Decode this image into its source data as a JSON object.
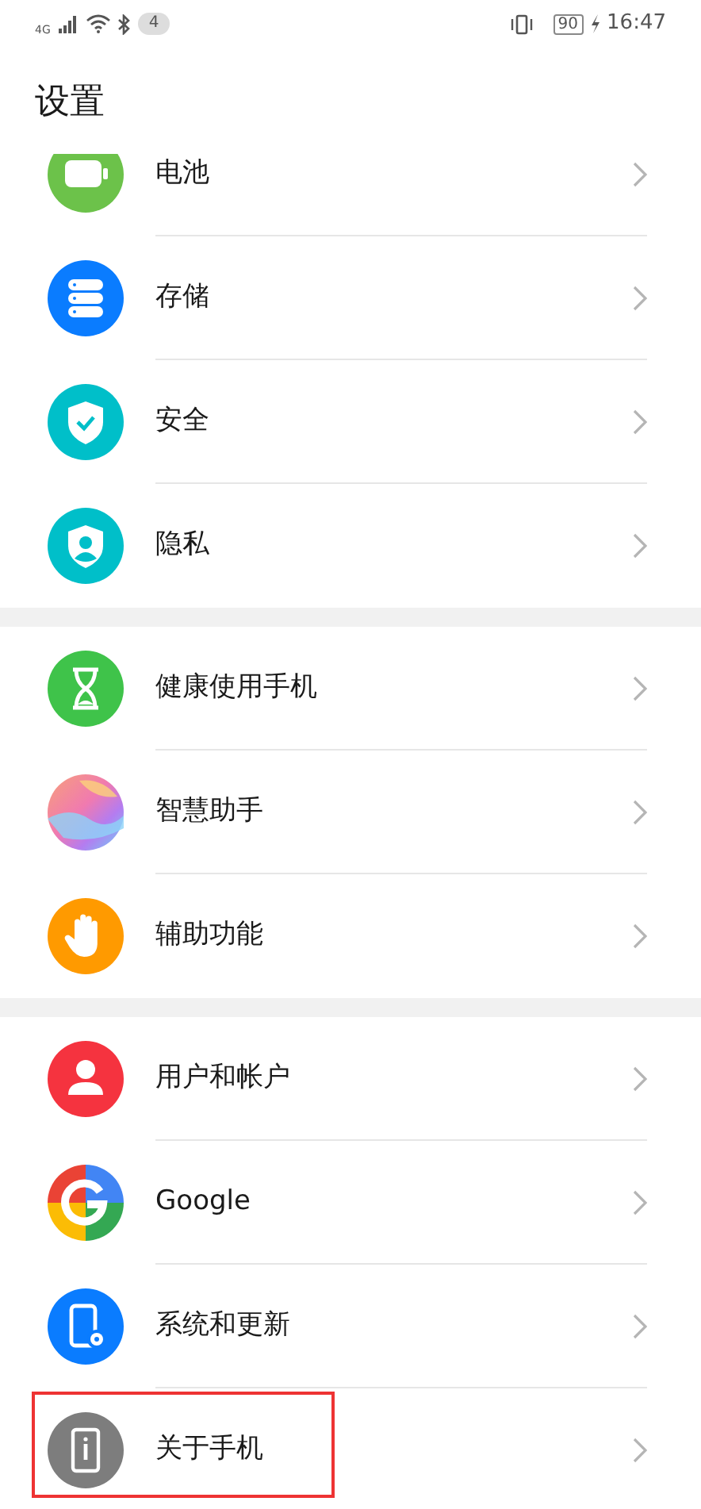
{
  "status_bar": {
    "network": "4G",
    "notification_count": "4",
    "battery": "90",
    "time": "16:47"
  },
  "title": "设置",
  "groups": [
    {
      "items": [
        {
          "label": "电池",
          "highlighted": false
        },
        {
          "label": "存储",
          "highlighted": false
        },
        {
          "label": "安全",
          "highlighted": false
        },
        {
          "label": "隐私",
          "highlighted": false
        }
      ]
    },
    {
      "items": [
        {
          "label": "健康使用手机",
          "highlighted": false
        },
        {
          "label": "智慧助手",
          "highlighted": false
        },
        {
          "label": "辅助功能",
          "highlighted": false
        }
      ]
    },
    {
      "items": [
        {
          "label": "用户和帐户",
          "highlighted": false
        },
        {
          "label": "Google",
          "highlighted": false
        },
        {
          "label": "系统和更新",
          "highlighted": false
        },
        {
          "label": "关于手机",
          "highlighted": true
        }
      ]
    }
  ]
}
